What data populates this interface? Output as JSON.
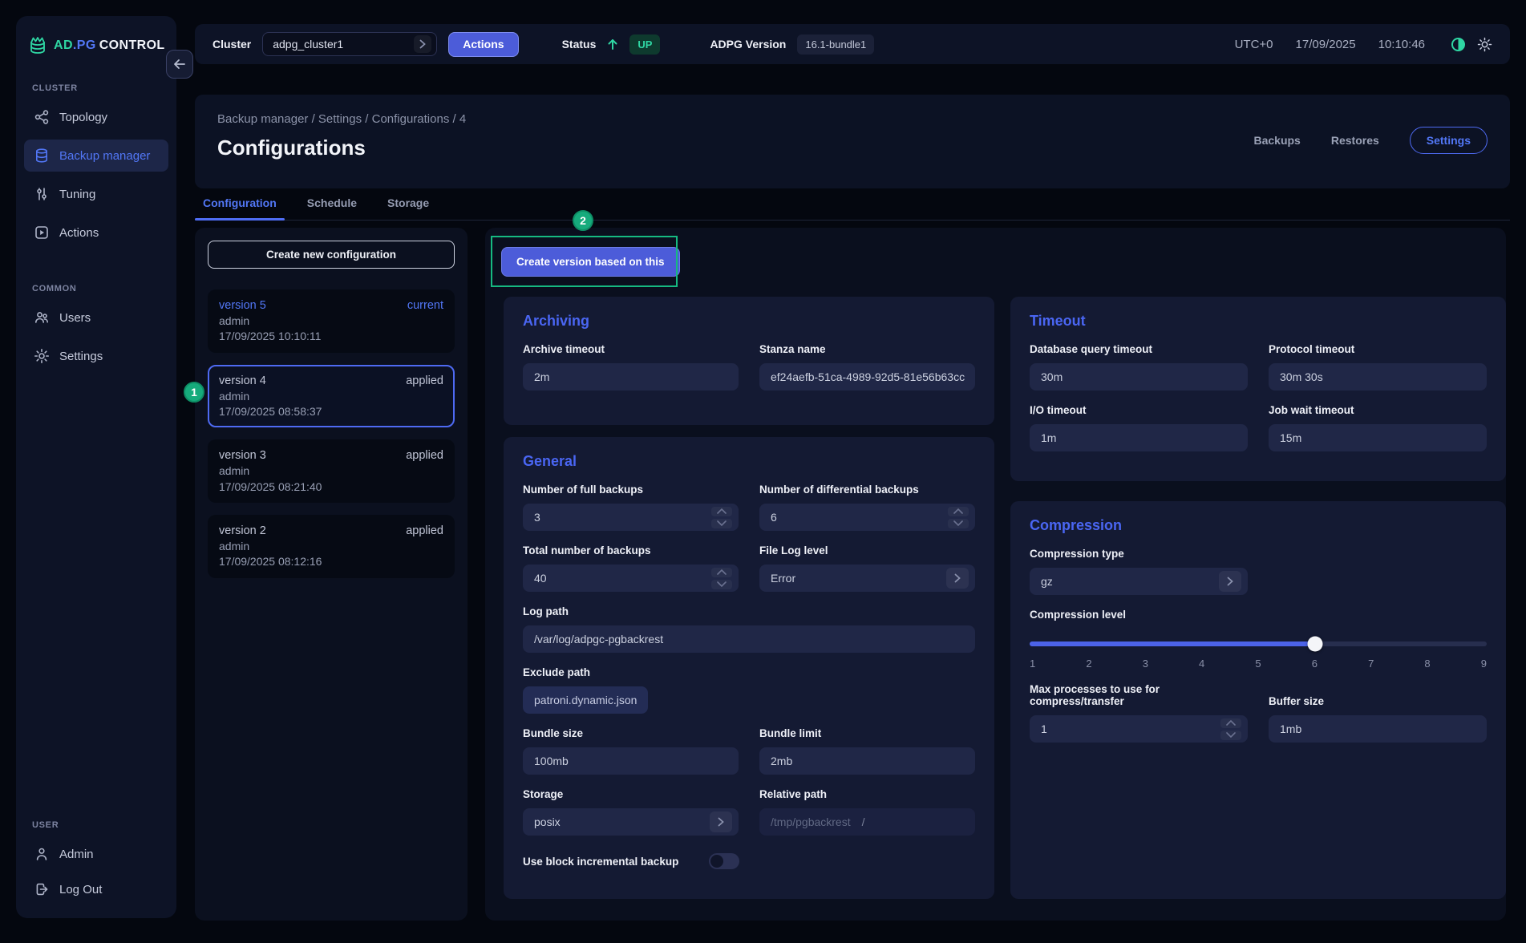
{
  "logo": {
    "ad": "AD",
    "pg": ".PG",
    "control": "CONTROL"
  },
  "topbar": {
    "cluster_label": "Cluster",
    "cluster_value": "adpg_cluster1",
    "actions_label": "Actions",
    "status_label": "Status",
    "status_value": "UP",
    "adpg_version_label": "ADPG Version",
    "adpg_version_value": "16.1-bundle1",
    "timezone": "UTC+0",
    "date": "17/09/2025",
    "time": "10:10:46"
  },
  "sidebar": {
    "cluster_section": {
      "label": "CLUSTER",
      "items": [
        {
          "label": "Topology"
        },
        {
          "label": "Backup manager"
        },
        {
          "label": "Tuning"
        },
        {
          "label": "Actions"
        }
      ]
    },
    "common_section": {
      "label": "COMMON",
      "items": [
        {
          "label": "Users"
        },
        {
          "label": "Settings"
        }
      ]
    },
    "user_section": {
      "label": "USER",
      "items": [
        {
          "label": "Admin"
        },
        {
          "label": "Log Out"
        }
      ]
    }
  },
  "header": {
    "breadcrumb": "Backup manager / Settings / Configurations / 4",
    "title": "Configurations",
    "nav": {
      "backups": "Backups",
      "restores": "Restores",
      "settings": "Settings"
    }
  },
  "tabs": [
    {
      "label": "Configuration"
    },
    {
      "label": "Schedule"
    },
    {
      "label": "Storage"
    }
  ],
  "annotations": {
    "badge1": "1",
    "badge2": "2"
  },
  "version_panel": {
    "create_button": "Create new configuration",
    "versions": [
      {
        "name": "version 5",
        "status": "current",
        "author": "admin",
        "timestamp": "17/09/2025 10:10:11"
      },
      {
        "name": "version 4",
        "status": "applied",
        "author": "admin",
        "timestamp": "17/09/2025 08:58:37"
      },
      {
        "name": "version 3",
        "status": "applied",
        "author": "admin",
        "timestamp": "17/09/2025 08:21:40"
      },
      {
        "name": "version 2",
        "status": "applied",
        "author": "admin",
        "timestamp": "17/09/2025 08:12:16"
      }
    ]
  },
  "main": {
    "create_version_button": "Create version based on this",
    "archiving": {
      "title": "Archiving",
      "archive_timeout_label": "Archive timeout",
      "archive_timeout_value": "2m",
      "stanza_name_label": "Stanza name",
      "stanza_name_value": "ef24aefb-51ca-4989-92d5-81e56b63cc"
    },
    "general": {
      "title": "General",
      "full_backups_label": "Number of full backups",
      "full_backups_value": "3",
      "diff_backups_label": "Number of differential backups",
      "diff_backups_value": "6",
      "total_backups_label": "Total number of backups",
      "total_backups_value": "40",
      "file_log_level_label": "File Log level",
      "file_log_level_value": "Error",
      "log_path_label": "Log path",
      "log_path_value": "/var/log/adpgc-pgbackrest",
      "exclude_path_label": "Exclude path",
      "exclude_path_value": "patroni.dynamic.json",
      "bundle_size_label": "Bundle size",
      "bundle_size_value": "100mb",
      "bundle_limit_label": "Bundle limit",
      "bundle_limit_value": "2mb",
      "storage_label": "Storage",
      "storage_value": "posix",
      "relative_path_label": "Relative path",
      "relative_path_value": "/tmp/pgbackrest",
      "relative_path_suffix": "/",
      "block_incremental_label": "Use block incremental backup",
      "block_incremental_enabled": false
    },
    "timeout": {
      "title": "Timeout",
      "db_query_label": "Database query timeout",
      "db_query_value": "30m",
      "protocol_label": "Protocol timeout",
      "protocol_value": "30m 30s",
      "io_label": "I/O timeout",
      "io_value": "1m",
      "job_wait_label": "Job wait timeout",
      "job_wait_value": "15m"
    },
    "compression": {
      "title": "Compression",
      "type_label": "Compression type",
      "type_value": "gz",
      "level_label": "Compression level",
      "level_value": 6,
      "level_min": 1,
      "level_max": 9,
      "level_ticks": [
        "1",
        "2",
        "3",
        "4",
        "5",
        "6",
        "7",
        "8",
        "9"
      ],
      "max_processes_label": "Max processes to use for compress/transfer",
      "max_processes_value": "1",
      "buffer_size_label": "Buffer size",
      "buffer_size_value": "1mb"
    }
  },
  "colors": {
    "accent_blue": "#4c5cd9",
    "link_blue": "#5277f6",
    "accent_green": "#16ab7c",
    "status_green": "#2fd6a3"
  },
  "icons": [
    "database-logo-icon",
    "back-arrow-icon",
    "chevron-right-icon",
    "arrow-up-icon",
    "contrast-icon",
    "sun-icon",
    "topology-icon",
    "database-icon",
    "sliders-icon",
    "play-square-icon",
    "users-icon",
    "gear-icon",
    "person-icon",
    "logout-icon",
    "stepper-up-icon",
    "stepper-down-icon",
    "toggle-switch"
  ]
}
